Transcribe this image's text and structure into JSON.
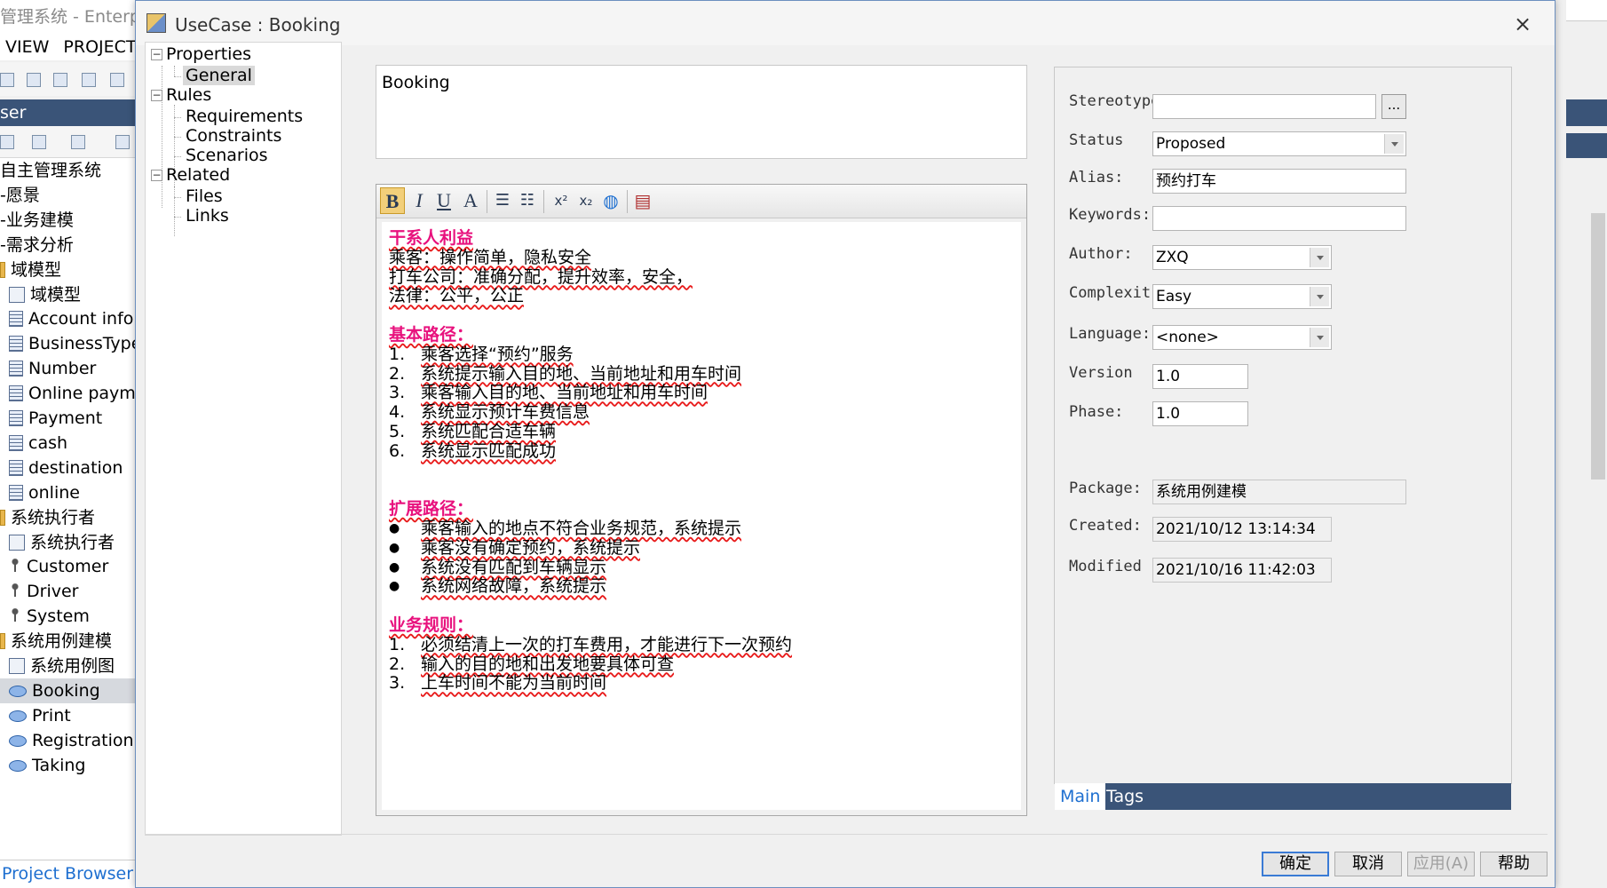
{
  "app": {
    "title_partial": "管理系统 - Enterprise",
    "menu": [
      "VIEW",
      "PROJECT"
    ],
    "panel_header": "ser",
    "project_browser_tab": "Project Browser",
    "tree": [
      {
        "label": "自主管理系统",
        "icon": "none",
        "indent": 0
      },
      {
        "label": "-愿景",
        "icon": "none",
        "indent": 0
      },
      {
        "label": "-业务建模",
        "icon": "none",
        "indent": 0
      },
      {
        "label": "-需求分析",
        "icon": "none",
        "indent": 0
      },
      {
        "label": "域模型",
        "icon": "folder-icon",
        "indent": 0
      },
      {
        "label": "域模型",
        "icon": "diagram-icon",
        "indent": 1
      },
      {
        "label": "Account information",
        "icon": "class-icon",
        "indent": 1
      },
      {
        "label": "BusinessType",
        "icon": "class-icon",
        "indent": 1
      },
      {
        "label": "Number",
        "icon": "class-icon",
        "indent": 1
      },
      {
        "label": "Online payment",
        "icon": "class-icon",
        "indent": 1
      },
      {
        "label": "Payment",
        "icon": "class-icon",
        "indent": 1
      },
      {
        "label": "cash",
        "icon": "class-icon",
        "indent": 1
      },
      {
        "label": "destination",
        "icon": "class-icon",
        "indent": 1
      },
      {
        "label": "online",
        "icon": "class-icon",
        "indent": 1
      },
      {
        "label": "系统执行者",
        "icon": "folder-icon",
        "indent": 0
      },
      {
        "label": "系统执行者",
        "icon": "diagram-icon",
        "indent": 1
      },
      {
        "label": "Customer",
        "icon": "actor-icon",
        "indent": 1
      },
      {
        "label": "Driver",
        "icon": "actor-icon",
        "indent": 1
      },
      {
        "label": "System",
        "icon": "actor-icon",
        "indent": 1
      },
      {
        "label": "系统用例建模",
        "icon": "folder-icon",
        "indent": 0
      },
      {
        "label": "系统用例图",
        "icon": "diagram-icon",
        "indent": 1
      },
      {
        "label": "Booking",
        "icon": "usecase-icon",
        "indent": 1,
        "selected": true
      },
      {
        "label": "Print",
        "icon": "usecase-icon",
        "indent": 1
      },
      {
        "label": "Registration information",
        "icon": "usecase-icon",
        "indent": 1
      },
      {
        "label": "Taking",
        "icon": "usecase-icon",
        "indent": 1
      }
    ]
  },
  "dialog": {
    "title": "UseCase : Booking",
    "close_label": "×",
    "nav": {
      "properties": "Properties",
      "general": "General",
      "rules": "Rules",
      "requirements": "Requirements",
      "constraints": "Constraints",
      "scenarios": "Scenarios",
      "related": "Related",
      "files": "Files",
      "links": "Links"
    },
    "name": "Booking",
    "toolbar": {
      "bold": "B",
      "italic": "I",
      "underline": "U",
      "font_color": "A",
      "bullets": "☰",
      "numbering": "☷",
      "superscript": "x²",
      "subscript": "x₂",
      "hyperlink": "◍",
      "doc": "▤"
    },
    "notes": {
      "stakeholders_title": "干系人利益",
      "stakeholders": [
        "乘客：操作简单，隐私安全",
        "打车公司：准确分配，提升效率，安全，",
        "法律：公平，公正"
      ],
      "basic_flow_title": "基本路径：",
      "basic_flow": [
        {
          "num": "1.",
          "text": "乘客选择“预约”服务"
        },
        {
          "num": "2.",
          "text": "系统提示输入目的地、当前地址和用车时间"
        },
        {
          "num": "3.",
          "text": "乘客输入目的地、当前地址和用车时间"
        },
        {
          "num": "4.",
          "text": "系统显示预计车费信息"
        },
        {
          "num": "5.",
          "text": "系统匹配合适车辆"
        },
        {
          "num": "6.",
          "text": "系统显示匹配成功"
        }
      ],
      "ext_flow_title": "扩展路径：",
      "ext_flow": [
        "乘客输入的地点不符合业务规范，系统提示",
        "乘客没有确定预约，系统提示",
        "系统没有匹配到车辆显示",
        "系统网络故障，系统提示"
      ],
      "rules_title": "业务规则：",
      "rules": [
        {
          "num": "1.",
          "text": "必须结清上一次的打车费用，才能进行下一次预约"
        },
        {
          "num": "2.",
          "text": "输入的目的地和出发地要具体可查"
        },
        {
          "num": "3.",
          "text": "上车时间不能为当前时间"
        }
      ]
    },
    "props": {
      "stereotype_label": "Stereotype",
      "stereotype_value": "",
      "stereotype_btn": "...",
      "status_label": "Status",
      "status_value": "Proposed",
      "alias_label": "Alias:",
      "alias_value": "预约打车",
      "keywords_label": "Keywords:",
      "keywords_value": "",
      "author_label": "Author:",
      "author_value": "ZXQ",
      "complexity_label": "Complexity",
      "complexity_value": "Easy",
      "language_label": "Language:",
      "language_value": "<none>",
      "version_label": "Version",
      "version_value": "1.0",
      "phase_label": "Phase:",
      "phase_value": "1.0",
      "package_label": "Package:",
      "package_value": "系统用例建模",
      "created_label": "Created:",
      "created_value": "2021/10/12 13:14:34",
      "modified_label": "Modified",
      "modified_value": "2021/10/16 11:42:03",
      "tab_main": "Main",
      "tab_tags": "Tags"
    },
    "buttons": {
      "ok": "确定",
      "cancel": "取消",
      "apply": "应用(A)",
      "help": "帮助"
    }
  }
}
